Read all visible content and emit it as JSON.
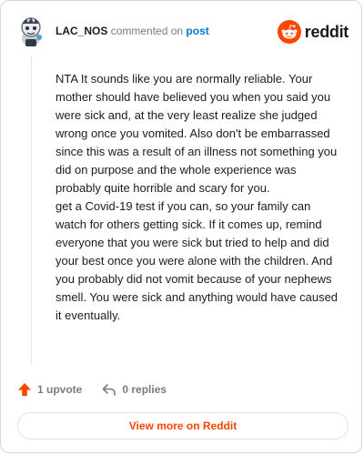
{
  "comment": {
    "username": "LAC_NOS",
    "action_text": "commented on",
    "post_link": "post",
    "avatar_icon": "snoo-avatar-icon",
    "paragraphs": [
      "NTA It sounds like you are normally reliable. Your mother should have believed you when you said you were sick and, at the very least realize she judged wrong once you vomited. Also don't be embarrassed since this was a result of an illness not something you did on purpose and the whole experience was probably quite horrible and scary for you.",
      "get a Covid-19 test if you can, so your family can watch for others getting sick. If it comes up, remind everyone that you were sick but tried to help and did your best once you were alone with the children. And you probably did not vomit because of your nephews smell. You were sick and anything would have caused it eventually."
    ]
  },
  "brand": {
    "name": "reddit",
    "icon": "reddit-logo-icon",
    "color": "#ff4500"
  },
  "footer": {
    "upvotes": "1 upvote",
    "upvote_icon": "upvote-arrow-icon",
    "upvote_color": "#ff4500",
    "replies": "0 replies",
    "reply_icon": "reply-arrow-icon"
  },
  "cta": {
    "label": "View more on Reddit"
  }
}
